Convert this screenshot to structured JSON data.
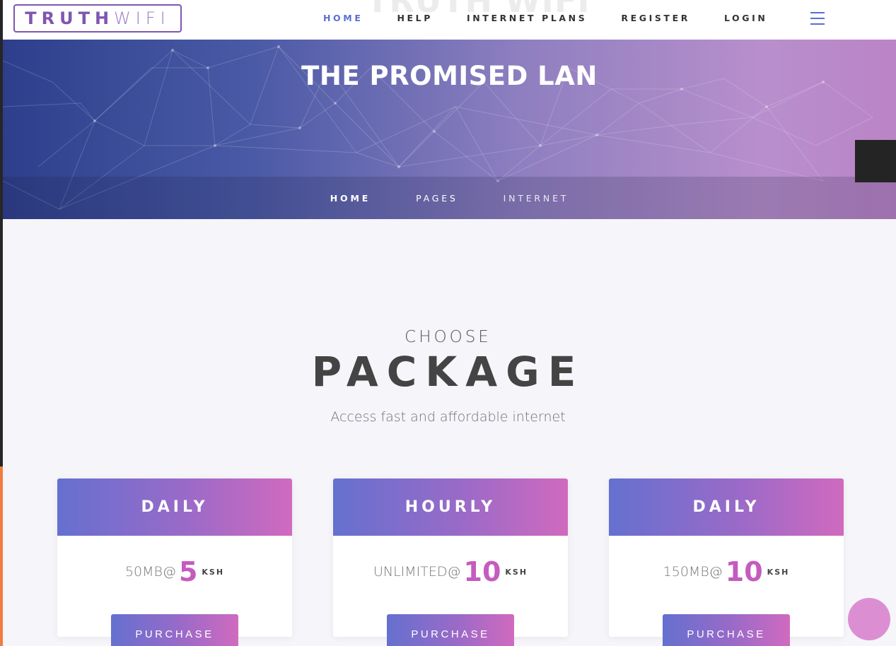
{
  "brand": {
    "logo_bold": "TRUTH",
    "logo_light": "WIFI",
    "ghost_text": "TRUTH WIFI",
    "accent": "#5a6fd1",
    "purple": "#7f56b0"
  },
  "nav": {
    "items": [
      "HOME",
      "HELP",
      "INTERNET PLANS",
      "REGISTER",
      "LOGIN"
    ],
    "active": "HOME",
    "menu_icon": "hamburger-icon"
  },
  "hero": {
    "title": "THE PROMISED LAN",
    "breadcrumbs": [
      "HOME",
      "PAGES",
      "INTERNET"
    ]
  },
  "section": {
    "kicker": "CHOOSE",
    "heading": "PACKAGE",
    "tagline": "Access fast and affordable internet"
  },
  "packages": [
    {
      "name": "DAILY",
      "amount_label": "50MB@",
      "price": "5",
      "currency": "KSH",
      "button": "PURCHASE"
    },
    {
      "name": "HOURLY",
      "amount_label": "UNLIMITED@",
      "price": "10",
      "currency": "KSH",
      "button": "PURCHASE"
    },
    {
      "name": "DAILY",
      "amount_label": "150MB@",
      "price": "10",
      "currency": "KSH",
      "button": "PURCHASE"
    }
  ]
}
